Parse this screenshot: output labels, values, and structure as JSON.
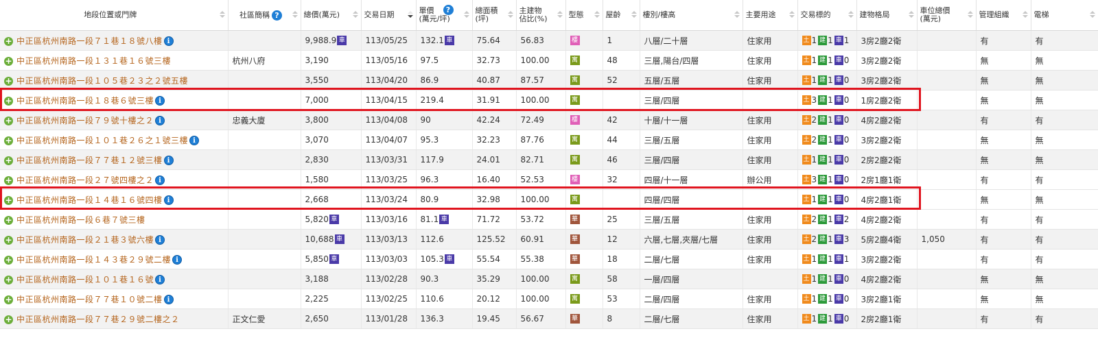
{
  "colors": {
    "type_building": "#e05fb7",
    "type_apartment": "#7a9a1a",
    "type_huaxia": "#a0553b"
  },
  "headers": [
    {
      "label": "地段位置或門牌"
    },
    {
      "label": "社區簡稱"
    },
    {
      "label": "總價(萬元)"
    },
    {
      "label": "交易日期"
    },
    {
      "label": "單價\n(萬元/坪)"
    },
    {
      "label": "總面積\n(坪)"
    },
    {
      "label": "主建物\n佔比(%)"
    },
    {
      "label": "型態"
    },
    {
      "label": "屋齡"
    },
    {
      "label": "樓別/樓高"
    },
    {
      "label": "主要用途"
    },
    {
      "label": "交易標的"
    },
    {
      "label": "建物格局"
    },
    {
      "label": "車位總價\n(萬元)"
    },
    {
      "label": "管理組織"
    },
    {
      "label": "電梯"
    }
  ],
  "icons": {
    "info": "i",
    "plus": "+",
    "car": "車",
    "land": "土",
    "bld": "建",
    "question": "?"
  },
  "rows": [
    {
      "addr": "中正區杭州南路一段７１巷１８號八樓",
      "info": true,
      "community": "",
      "price": "9,988.9",
      "price_car": true,
      "date": "113/05/25",
      "unit": "132.1",
      "unit_car": true,
      "area": "75.64",
      "ratio": "56.83",
      "type": "樓",
      "type_kind": "building",
      "age": "1",
      "floor": "八層/二十層",
      "use": "住家用",
      "land": "1",
      "bld": "1",
      "car": "1",
      "layout": "3房2廳2衛",
      "carprice": "",
      "mgmt": "有",
      "elev": "有"
    },
    {
      "addr": "中正區杭州南路一段１３１巷１６號三樓",
      "info": false,
      "community": "杭州八府",
      "price": "3,190",
      "price_car": false,
      "date": "113/05/16",
      "unit": "97.5",
      "unit_car": false,
      "area": "32.73",
      "ratio": "100.00",
      "type": "寓",
      "type_kind": "apartment",
      "age": "48",
      "floor": "三層,陽台/四層",
      "use": "住家用",
      "land": "1",
      "bld": "1",
      "car": "0",
      "layout": "3房2廳2衛",
      "carprice": "",
      "mgmt": "無",
      "elev": "無"
    },
    {
      "addr": "中正區杭州南路一段１０５巷２３之２號五樓",
      "info": false,
      "community": "",
      "price": "3,550",
      "price_car": false,
      "date": "113/04/20",
      "unit": "86.9",
      "unit_car": false,
      "area": "40.87",
      "ratio": "87.57",
      "type": "寓",
      "type_kind": "apartment",
      "age": "52",
      "floor": "五層/五層",
      "use": "住家用",
      "land": "1",
      "bld": "1",
      "car": "0",
      "layout": "3房2廳2衛",
      "carprice": "",
      "mgmt": "無",
      "elev": "無"
    },
    {
      "addr": "中正區杭州南路一段１８巷６號三樓",
      "info": true,
      "community": "",
      "price": "7,000",
      "price_car": false,
      "date": "113/04/15",
      "unit": "219.4",
      "unit_car": false,
      "area": "31.91",
      "ratio": "100.00",
      "type": "寓",
      "type_kind": "apartment",
      "age": "",
      "floor": "三層/四層",
      "use": "",
      "land": "3",
      "bld": "1",
      "car": "0",
      "layout": "1房2廳2衛",
      "carprice": "",
      "mgmt": "無",
      "elev": "無"
    },
    {
      "addr": "中正區杭州南路一段７９號十樓之２",
      "info": true,
      "community": "忠義大廈",
      "price": "3,800",
      "price_car": false,
      "date": "113/04/08",
      "unit": "90",
      "unit_car": false,
      "area": "42.24",
      "ratio": "72.49",
      "type": "樓",
      "type_kind": "building",
      "age": "42",
      "floor": "十層/十一層",
      "use": "住家用",
      "land": "2",
      "bld": "1",
      "car": "0",
      "layout": "4房2廳2衛",
      "carprice": "",
      "mgmt": "有",
      "elev": "有"
    },
    {
      "addr": "中正區杭州南路一段１０１巷２６之１號三樓",
      "info": true,
      "community": "",
      "price": "3,070",
      "price_car": false,
      "date": "113/04/07",
      "unit": "95.3",
      "unit_car": false,
      "area": "32.23",
      "ratio": "87.76",
      "type": "寓",
      "type_kind": "apartment",
      "age": "44",
      "floor": "三層/五層",
      "use": "住家用",
      "land": "2",
      "bld": "1",
      "car": "0",
      "layout": "3房2廳2衛",
      "carprice": "",
      "mgmt": "無",
      "elev": "無"
    },
    {
      "addr": "中正區杭州南路一段７７巷１２號三樓",
      "info": true,
      "community": "",
      "price": "2,830",
      "price_car": false,
      "date": "113/03/31",
      "unit": "117.9",
      "unit_car": false,
      "area": "24.01",
      "ratio": "82.71",
      "type": "寓",
      "type_kind": "apartment",
      "age": "46",
      "floor": "三層/四層",
      "use": "住家用",
      "land": "1",
      "bld": "1",
      "car": "0",
      "layout": "2房2廳2衛",
      "carprice": "",
      "mgmt": "無",
      "elev": "無"
    },
    {
      "addr": "中正區杭州南路一段２７號四樓之２",
      "info": true,
      "community": "",
      "price": "1,580",
      "price_car": false,
      "date": "113/03/25",
      "unit": "96.3",
      "unit_car": false,
      "area": "16.40",
      "ratio": "52.53",
      "type": "樓",
      "type_kind": "building",
      "age": "32",
      "floor": "四層/十一層",
      "use": "辦公用",
      "land": "3",
      "bld": "1",
      "car": "0",
      "layout": "2房1廳1衛",
      "carprice": "",
      "mgmt": "有",
      "elev": "有"
    },
    {
      "addr": "中正區杭州南路一段１４巷１６號四樓",
      "info": true,
      "community": "",
      "price": "2,668",
      "price_car": false,
      "date": "113/03/24",
      "unit": "80.9",
      "unit_car": false,
      "area": "32.98",
      "ratio": "100.00",
      "type": "寓",
      "type_kind": "apartment",
      "age": "",
      "floor": "四層/四層",
      "use": "",
      "land": "1",
      "bld": "1",
      "car": "0",
      "layout": "4房2廳1衛",
      "carprice": "",
      "mgmt": "無",
      "elev": "無"
    },
    {
      "addr": "中正區杭州南路一段６巷７號三樓",
      "info": false,
      "community": "",
      "price": "5,820",
      "price_car": true,
      "date": "113/03/16",
      "unit": "81.1",
      "unit_car": true,
      "area": "71.72",
      "ratio": "53.72",
      "type": "華",
      "type_kind": "huaxia",
      "age": "25",
      "floor": "三層/五層",
      "use": "住家用",
      "land": "2",
      "bld": "1",
      "car": "2",
      "layout": "4房2廳2衛",
      "carprice": "",
      "mgmt": "有",
      "elev": "有"
    },
    {
      "addr": "中正區杭州南路一段２１巷３號六樓",
      "info": true,
      "community": "",
      "price": "10,688",
      "price_car": true,
      "date": "113/03/13",
      "unit": "112.6",
      "unit_car": false,
      "area": "125.52",
      "ratio": "60.91",
      "type": "華",
      "type_kind": "huaxia",
      "age": "12",
      "floor": "六層,七層,夾層/七層",
      "use": "住家用",
      "land": "2",
      "bld": "1",
      "car": "3",
      "layout": "5房2廳4衛",
      "carprice": "1,050",
      "mgmt": "有",
      "elev": "有"
    },
    {
      "addr": "中正區杭州南路一段１４３巷２９號二樓",
      "info": true,
      "community": "",
      "price": "5,850",
      "price_car": true,
      "date": "113/03/03",
      "unit": "105.3",
      "unit_car": true,
      "area": "55.54",
      "ratio": "55.38",
      "type": "華",
      "type_kind": "huaxia",
      "age": "18",
      "floor": "二層/七層",
      "use": "住家用",
      "land": "1",
      "bld": "1",
      "car": "1",
      "layout": "3房2廳2衛",
      "carprice": "",
      "mgmt": "有",
      "elev": "有"
    },
    {
      "addr": "中正區杭州南路一段１０１巷１６號",
      "info": true,
      "community": "",
      "price": "3,188",
      "price_car": false,
      "date": "113/02/28",
      "unit": "90.3",
      "unit_car": false,
      "area": "35.29",
      "ratio": "100.00",
      "type": "寓",
      "type_kind": "apartment",
      "age": "58",
      "floor": "一層/四層",
      "use": "",
      "land": "1",
      "bld": "1",
      "car": "0",
      "layout": "4房2廳2衛",
      "carprice": "",
      "mgmt": "無",
      "elev": "無"
    },
    {
      "addr": "中正區杭州南路一段７７巷１０號二樓",
      "info": true,
      "community": "",
      "price": "2,225",
      "price_car": false,
      "date": "113/02/25",
      "unit": "110.6",
      "unit_car": false,
      "area": "20.12",
      "ratio": "100.00",
      "type": "寓",
      "type_kind": "apartment",
      "age": "53",
      "floor": "二層/四層",
      "use": "住家用",
      "land": "1",
      "bld": "1",
      "car": "0",
      "layout": "3房2廳1衛",
      "carprice": "",
      "mgmt": "無",
      "elev": "無"
    },
    {
      "addr": "中正區杭州南路一段７７巷２９號二樓之２",
      "info": false,
      "community": "正文仁愛",
      "price": "2,650",
      "price_car": false,
      "date": "113/01/28",
      "unit": "136.3",
      "unit_car": false,
      "area": "19.45",
      "ratio": "56.67",
      "type": "華",
      "type_kind": "huaxia",
      "age": "8",
      "floor": "二層/七層",
      "use": "住家用",
      "land": "1",
      "bld": "1",
      "car": "0",
      "layout": "2房2廳1衛",
      "carprice": "",
      "mgmt": "有",
      "elev": "有"
    }
  ]
}
